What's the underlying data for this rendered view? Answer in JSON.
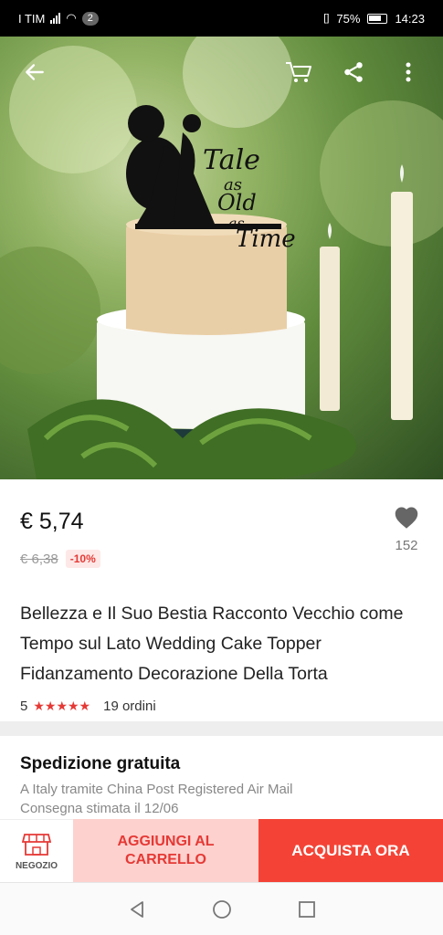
{
  "status_bar": {
    "carrier": "I TIM",
    "badge": "2",
    "battery": "75%",
    "time": "14:23"
  },
  "toolbar": {
    "back_icon": "arrow-left-icon",
    "cart_icon": "cart-icon",
    "share_icon": "share-icon",
    "more_icon": "more-vertical-icon"
  },
  "product": {
    "topper_text": [
      "Tale",
      "as",
      "Old",
      "as",
      "Time"
    ],
    "price": "€ 5,74",
    "old_price": "€ 6,38",
    "discount": "-10%",
    "wishlist_count": "152",
    "title": "Bellezza e Il Suo Bestia Racconto Vecchio come Tempo sul Lato Wedding Cake Topper Fidanzamento Decorazione Della Torta",
    "rating": "5",
    "stars": "★★★★★",
    "orders": "19 ordini"
  },
  "shipping": {
    "title": "Spedizione gratuita",
    "method": "A Italy tramite China Post Registered Air Mail",
    "estimate": "Consegna stimata il 12/06"
  },
  "actions": {
    "store_label": "NEGOZIO",
    "add_to_cart": "AGGIUNGI AL CARRELLO",
    "buy_now": "ACQUISTA ORA"
  },
  "colors": {
    "accent": "#f44336",
    "accent_light": "#fdd1ce",
    "discount_bg": "#fde8e7"
  }
}
